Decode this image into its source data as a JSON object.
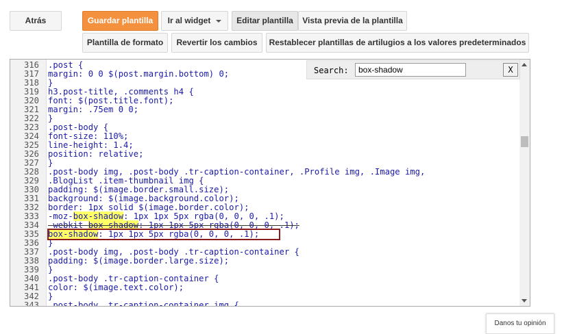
{
  "toolbar": {
    "back_label": "Atrás",
    "save_label": "Guardar plantilla",
    "widget_label": "Ir al widget",
    "edit_label": "Editar plantilla",
    "preview_label": "Vista previa de la plantilla",
    "format_label": "Plantilla de formato",
    "revert_label": "Revertir los cambios",
    "reset_label": "Restablecer plantillas de artilugios a los valores predeterminados"
  },
  "search": {
    "label": "Search:",
    "value": "box-shadow",
    "close_label": "X"
  },
  "editor": {
    "lines": [
      {
        "n": "316",
        "t": ".post {"
      },
      {
        "n": "317",
        "t": "margin: 0 0 $(post.margin.bottom) 0;"
      },
      {
        "n": "318",
        "t": "}"
      },
      {
        "n": "319",
        "t": "h3.post-title, .comments h4 {"
      },
      {
        "n": "320",
        "t": "font: $(post.title.font);"
      },
      {
        "n": "321",
        "t": "margin: .75em 0 0;"
      },
      {
        "n": "322",
        "t": "}"
      },
      {
        "n": "323",
        "t": ".post-body {"
      },
      {
        "n": "324",
        "t": "font-size: 110%;"
      },
      {
        "n": "325",
        "t": "line-height: 1.4;"
      },
      {
        "n": "326",
        "t": "position: relative;"
      },
      {
        "n": "327",
        "t": "}"
      },
      {
        "n": "328",
        "t": ".post-body img, .post-body .tr-caption-container, .Profile img, .Image img,"
      },
      {
        "n": "329",
        "t": ".BlogList .item-thumbnail img {"
      },
      {
        "n": "330",
        "t": "padding: $(image.border.small.size);"
      },
      {
        "n": "331",
        "t": "background: $(image.background.color);"
      },
      {
        "n": "332",
        "t": "border: 1px solid $(image.border.color);"
      },
      {
        "n": "333",
        "pre": "-moz-",
        "hl": "box-shadow",
        "post": ": 1px 1px 5px rgba(0, 0, 0, .1);"
      },
      {
        "n": "334",
        "pre": "-webkit-",
        "hl": "box-shadow",
        "post": ": 1px 1px 5px rgba(0, 0, 0, .1);"
      },
      {
        "n": "335",
        "pre": "",
        "hl": "box-shadow",
        "post": ": 1px 1px 5px rgba(0, 0, 0, .1);"
      },
      {
        "n": "336",
        "t": "}"
      },
      {
        "n": "337",
        "t": ".post-body img, .post-body .tr-caption-container {"
      },
      {
        "n": "338",
        "t": "padding: $(image.border.large.size);"
      },
      {
        "n": "339",
        "t": "}"
      },
      {
        "n": "340",
        "t": ".post-body .tr-caption-container {"
      },
      {
        "n": "341",
        "t": "color: $(image.text.color);"
      },
      {
        "n": "342",
        "t": "}"
      },
      {
        "n": "343",
        "t": ".post-body .tr-caption-container img {"
      }
    ]
  },
  "feedback_label": "Danos tu opinión"
}
